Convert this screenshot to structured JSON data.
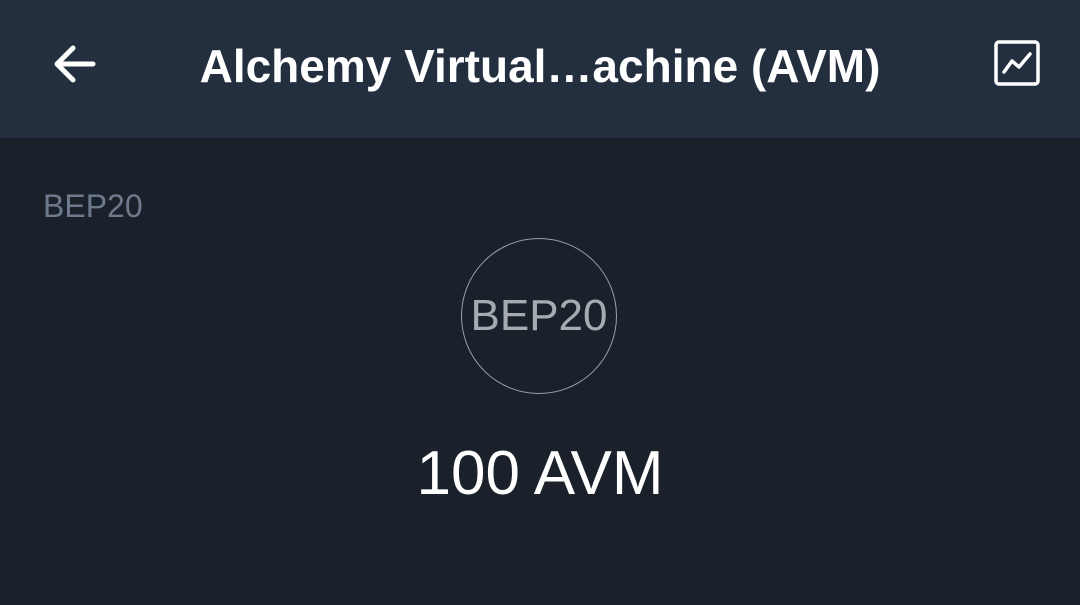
{
  "header": {
    "title": "Alchemy Virtual…achine (AVM)",
    "back_icon": "arrow-left-icon",
    "chart_icon": "chart-icon"
  },
  "main": {
    "network_label": "BEP20",
    "token_logo_text": "BEP20",
    "amount": "100 AVM"
  },
  "colors": {
    "header_bg": "#232f3e",
    "body_bg": "#1b212b",
    "muted_text": "#6d7a8c",
    "primary_text": "#ffffff"
  }
}
